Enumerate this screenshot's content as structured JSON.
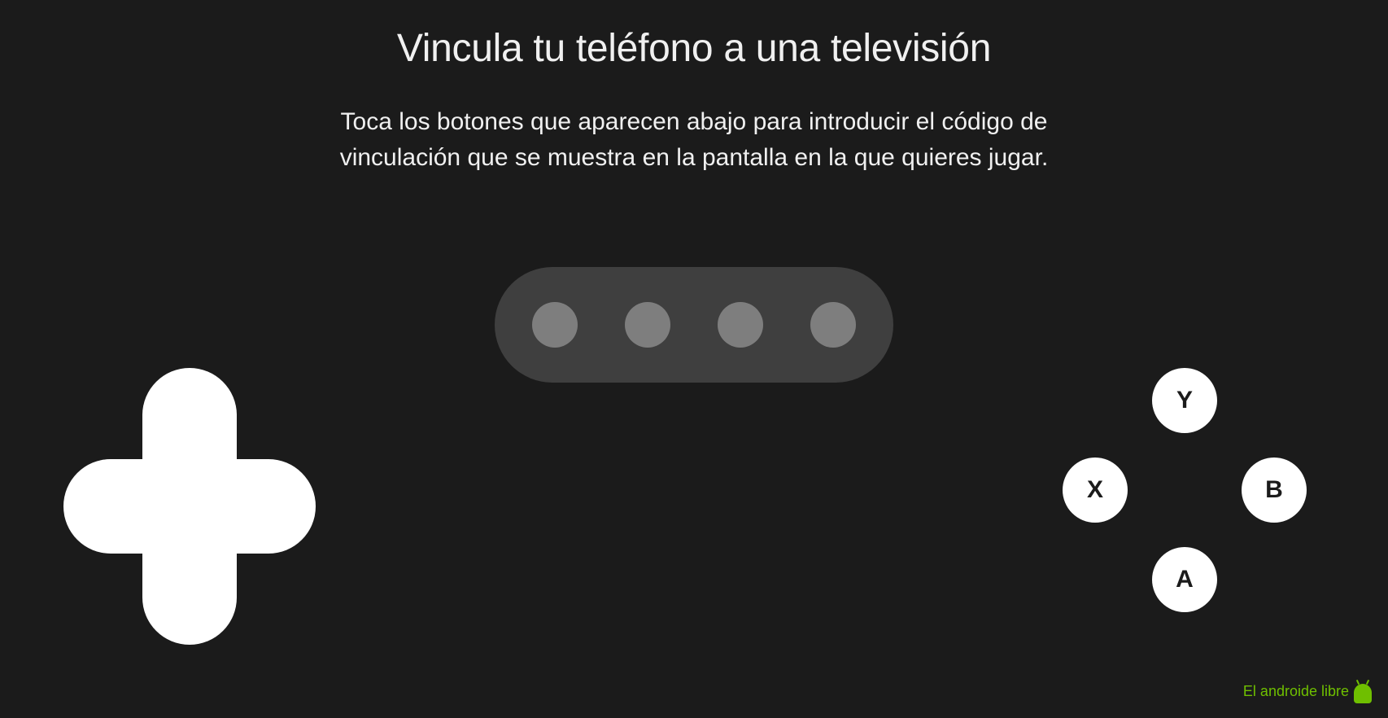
{
  "header": {
    "title": "Vincula tu teléfono a una televisión",
    "description": "Toca los botones que aparecen abajo para introducir el código de vinculación que se muestra en la pantalla en la que quieres jugar."
  },
  "code_input": {
    "digits_count": 4
  },
  "gamepad": {
    "buttons": {
      "y": "Y",
      "x": "X",
      "b": "B",
      "a": "A"
    }
  },
  "watermark": {
    "text": "El androide libre"
  }
}
